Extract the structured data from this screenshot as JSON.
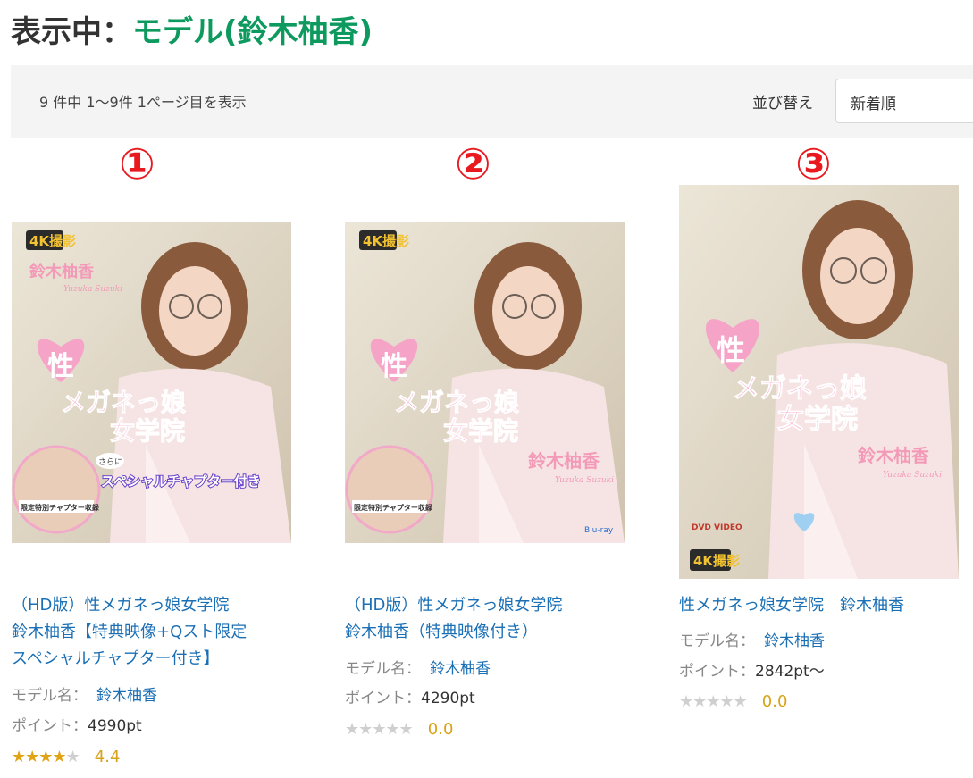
{
  "heading": {
    "prefix": "表示中：",
    "model": "モデル(鈴木柚香)"
  },
  "toolbar": {
    "result_count": "9 件中 1～9件 1ページ目を表示",
    "sort_label": "並び替え",
    "sort_value": "新着順"
  },
  "markers": [
    "①",
    "②",
    "③"
  ],
  "colors": {
    "accent_green": "#0e9a5e",
    "link_blue": "#1a6fb5",
    "marker_red": "#e8191f",
    "star_gold": "#e0a313"
  },
  "products": [
    {
      "title_line1": "（HD版）性メガネっ娘女学院",
      "title_line2": "鈴木柚香【特典映像+Qスト限定",
      "title_line3": "スペシャルチャプター付き】",
      "model_label": "モデル名：",
      "model_name": "鈴木柚香",
      "points_label": "ポイント：",
      "points": "4990pt",
      "rating": 4.4,
      "rating_text": "4.4",
      "cover": {
        "badge": "4K撮影",
        "name_jp": "鈴木柚香",
        "name_en": "Yuzuka Suzuki",
        "title_big": "性",
        "title_line1": "メガネっ娘",
        "title_line2": "女学院",
        "bonus_small": "さらに",
        "bonus_text": "スペシャルチャプター付き",
        "inset_caption": "限定特別チャプター収録"
      }
    },
    {
      "title_line1": "（HD版）性メガネっ娘女学院",
      "title_line2": "鈴木柚香（特典映像付き）",
      "model_label": "モデル名：",
      "model_name": "鈴木柚香",
      "points_label": "ポイント：",
      "points": "4290pt",
      "rating": 0,
      "rating_text": "0.0",
      "cover": {
        "badge": "4K撮影",
        "name_jp": "鈴木柚香",
        "name_en": "Yuzuka Suzuki",
        "title_big": "性",
        "title_line1": "メガネっ娘",
        "title_line2": "女学院",
        "inset_caption": "限定特別チャプター収録",
        "disc": "Blu-ray"
      }
    },
    {
      "title_line1": "性メガネっ娘女学院　鈴木柚香",
      "model_label": "モデル名：",
      "model_name": "鈴木柚香",
      "points_label": "ポイント：",
      "points": "2842pt～",
      "rating": 0,
      "rating_text": "0.0",
      "cover": {
        "badge": "4K撮影",
        "name_jp": "鈴木柚香",
        "name_en": "Yuzuka Suzuki",
        "title_big": "性",
        "title_line1": "メガネっ娘",
        "title_line2": "女学院",
        "disc": "DVD VIDEO"
      }
    }
  ]
}
